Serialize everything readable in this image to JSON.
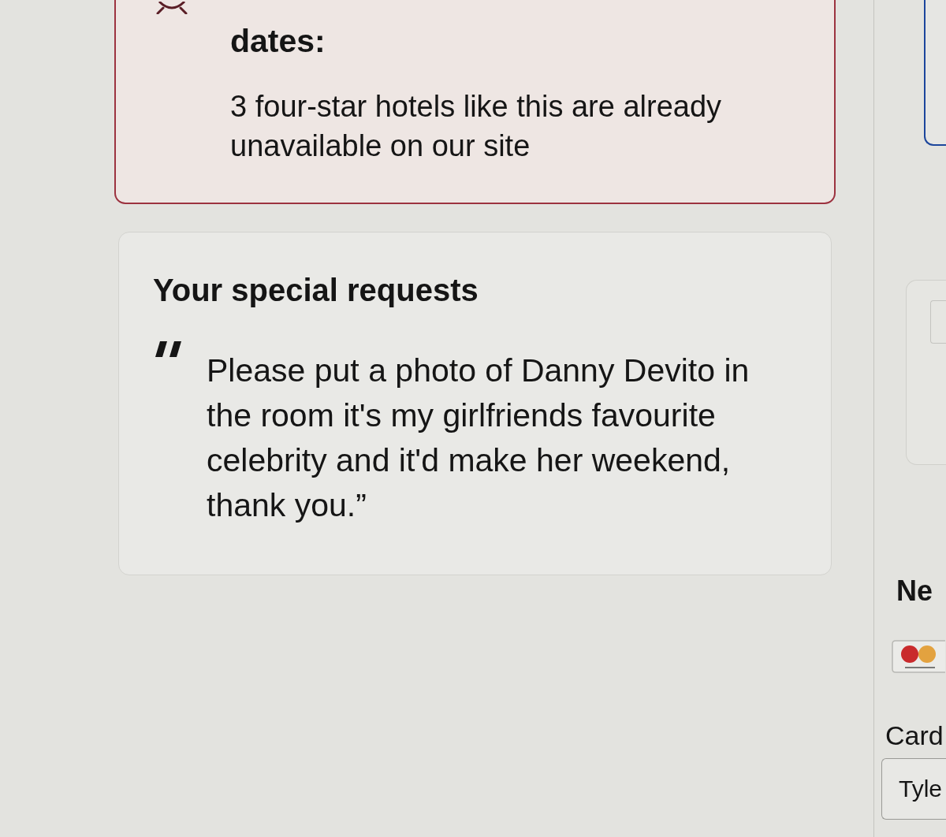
{
  "limited_supply_alert": {
    "heading": "dates:",
    "message": "3 four-star hotels like this are already unavailable on our site"
  },
  "special_requests": {
    "title": "Your special requests",
    "quote": "Please put a photo of Danny Devito in the room it's my girlfriends favourite celebrity and it'd make her weekend, thank you.”"
  },
  "payment": {
    "heading": "Ne",
    "card_label": "Card",
    "cardholder_field": {
      "value": "Tyle"
    }
  }
}
